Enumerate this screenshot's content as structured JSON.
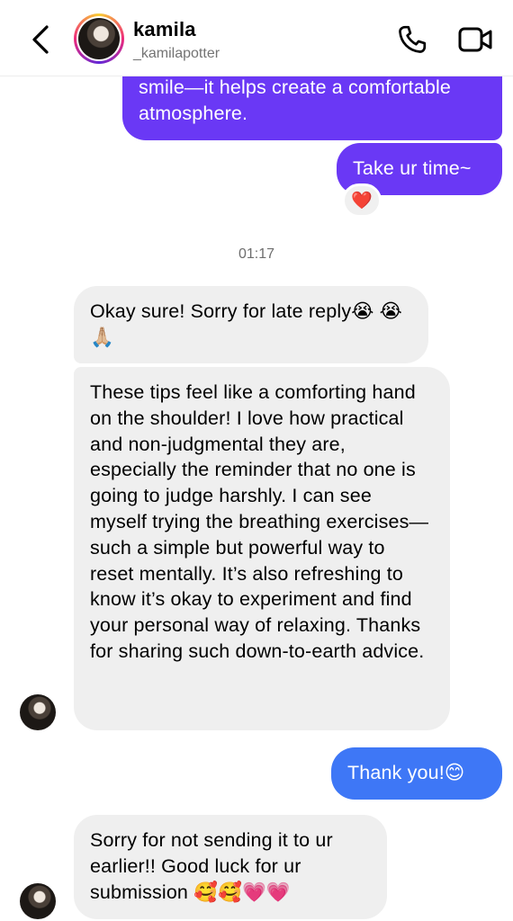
{
  "header": {
    "title": "kamila",
    "subtitle": "_kamilapotter",
    "icons": {
      "back": "chevron-left-icon",
      "call": "phone-icon",
      "video": "video-camera-icon"
    }
  },
  "messages": [
    {
      "direction": "outgoing",
      "text": "smile—it helps create a comfortable atmosphere."
    },
    {
      "direction": "outgoing",
      "text": "Take ur time~",
      "reaction": "❤️"
    },
    {
      "type": "timestamp",
      "text": "01:17"
    },
    {
      "direction": "incoming",
      "text": "Okay sure! Sorry for late reply😭 😭🙏🏼"
    },
    {
      "direction": "incoming",
      "text": "These tips feel like a comforting hand on the shoulder! I love how practical and non-judgmental they are, especially the reminder that no one is going to judge harshly. I can see myself trying the breathing exercises—such a simple but powerful way to reset mentally. It’s also refreshing to know it’s okay to experiment and find your personal way of relaxing. Thanks for sharing such down-to-earth advice."
    },
    {
      "direction": "outgoing",
      "text": "Thank you!😊"
    },
    {
      "direction": "incoming",
      "text": "Sorry for not sending it to ur earlier!! Good luck for ur submission 🥰🥰💗💗"
    }
  ],
  "colors": {
    "outgoing_purple": "#6a38f5",
    "outgoing_blue": "#3e77f6",
    "incoming": "#efefef"
  }
}
